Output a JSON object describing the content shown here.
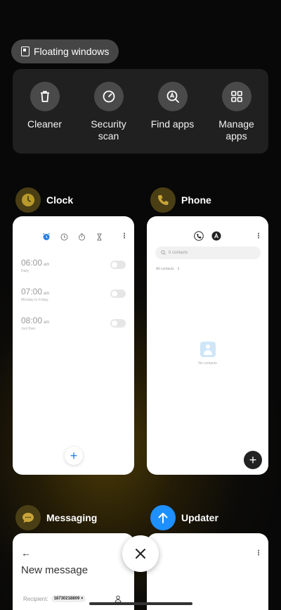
{
  "floating_windows": {
    "label": "Floating windows"
  },
  "tools": [
    {
      "label": "Cleaner",
      "icon": "trash-icon"
    },
    {
      "label": "Security scan",
      "icon": "gauge-icon"
    },
    {
      "label": "Find apps",
      "icon": "search-apps-icon"
    },
    {
      "label": "Manage apps",
      "icon": "grid-icon"
    }
  ],
  "apps": {
    "clock": {
      "name": "Clock",
      "alarms": [
        {
          "time": "06:00",
          "ampm": "am",
          "repeat": "Daily",
          "enabled": false
        },
        {
          "time": "07:00",
          "ampm": "am",
          "repeat": "Monday to Friday",
          "enabled": false
        },
        {
          "time": "08:00",
          "ampm": "am",
          "repeat": "Just then",
          "enabled": false
        }
      ]
    },
    "phone": {
      "name": "Phone",
      "search_placeholder": "0 contacts",
      "filter_label": "All contacts",
      "empty_text": "No contacts"
    },
    "messaging": {
      "name": "Messaging",
      "back_arrow": "←",
      "title": "New message",
      "recipient_label": "Recipient:",
      "recipient_chip": "18730218809 ×"
    },
    "updater": {
      "name": "Updater"
    }
  },
  "colors": {
    "clock_accent": "#2a7de1",
    "updater_icon": "#1e90ff",
    "app_icon_bg": "#4a3e14"
  }
}
